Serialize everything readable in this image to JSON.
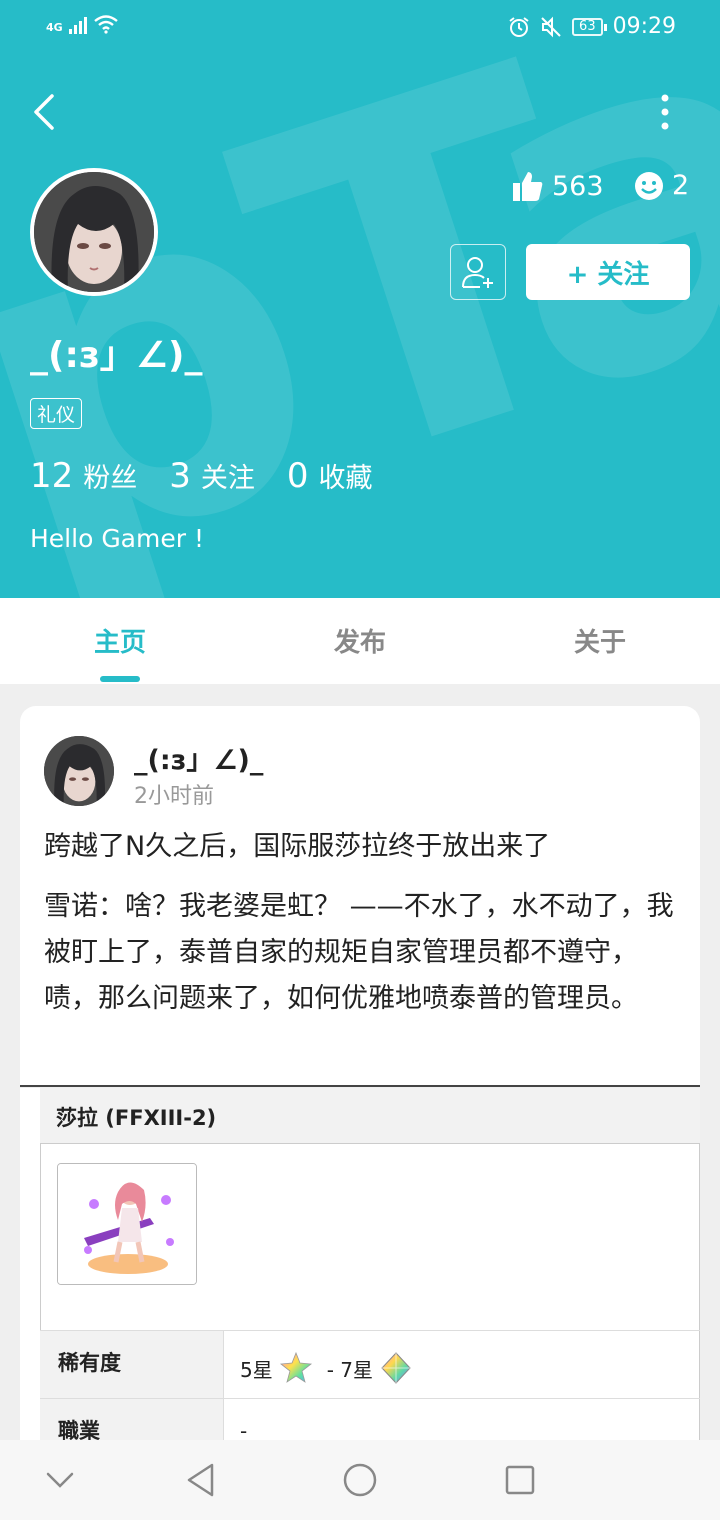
{
  "status_bar": {
    "network": "4G",
    "battery": "63",
    "time": "09:29"
  },
  "profile": {
    "username": "_(:з」∠)_",
    "badge": "礼仪",
    "likes": "563",
    "emoji_count": "2",
    "follow_label": "+ 关注",
    "counts": [
      {
        "num": "12",
        "label": "粉丝"
      },
      {
        "num": "3",
        "label": "关注"
      },
      {
        "num": "0",
        "label": "收藏"
      }
    ],
    "bio": "Hello Gamer !"
  },
  "tabs": [
    {
      "label": "主页",
      "active": true
    },
    {
      "label": "发布",
      "active": false
    },
    {
      "label": "关于",
      "active": false
    }
  ],
  "post": {
    "author": "_(:з」∠)_",
    "time": "2小时前",
    "title": "跨越了N久之后，国际服莎拉终于放出来了",
    "body": "雪诺：啥？我老婆是虹？ ——不水了，水不动了，我被盯上了，泰普自家的规矩自家管理员都不遵守，啧，那么问题来了，如何优雅地喷泰普的管理员。"
  },
  "embed": {
    "header": "莎拉 (FFXIII-2)",
    "rows": [
      {
        "key": "稀有度",
        "value_a": "5星",
        "value_b": "- 7星"
      },
      {
        "key": "職業",
        "value": "-"
      }
    ]
  },
  "colors": {
    "accent": "#26bcc8"
  }
}
